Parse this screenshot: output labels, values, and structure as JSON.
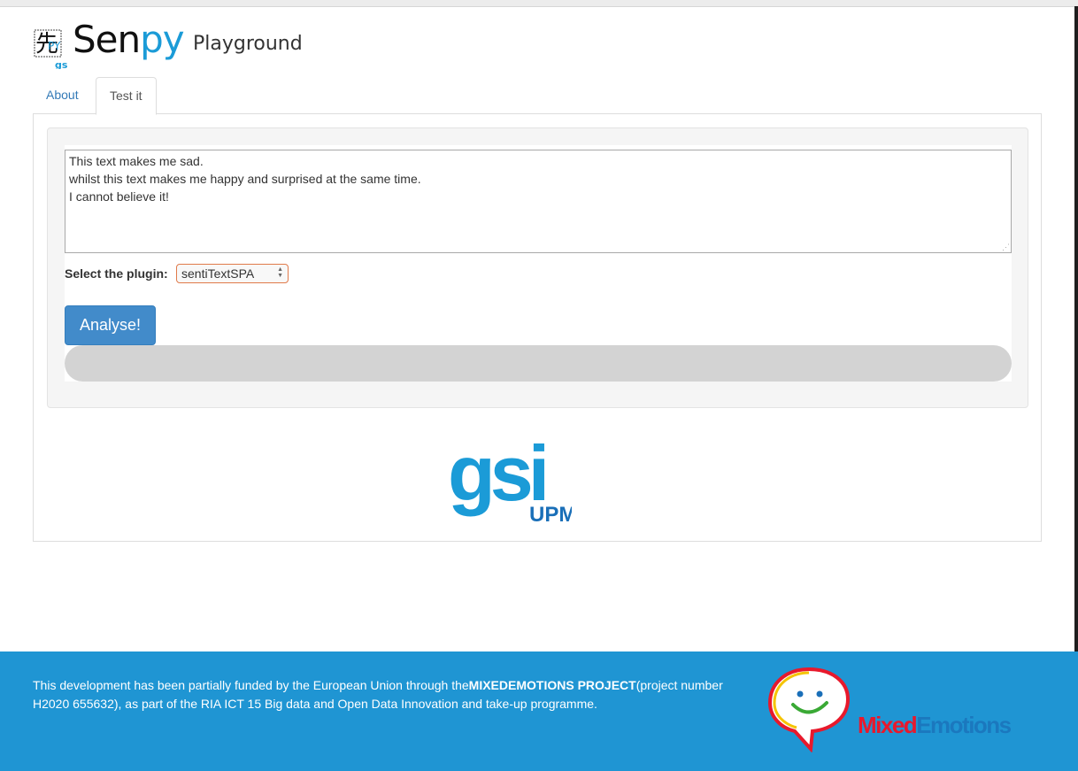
{
  "app": {
    "brand_sen": "Sen",
    "brand_py": "py",
    "brand_sub": "Playground"
  },
  "tabs": [
    {
      "label": "About",
      "active": false
    },
    {
      "label": "Test it",
      "active": true
    }
  ],
  "form": {
    "text_lines": [
      "This text makes me sad.",
      "whilst this text makes me happy and surprised at the same time.",
      "I cannot believe it!"
    ],
    "plugin_label": "Select the plugin:",
    "plugin_selected": "sentiTextSPA",
    "analyse_button": "Analyse!",
    "progress": 0
  },
  "gsi_logo": {
    "text": "gsi",
    "sub": "UPM"
  },
  "footer": {
    "text_before": "This development has been partially funded by the European Union through the",
    "project_name": "MIXEDEMOTIONS PROJECT",
    "text_after": "(project number H2020 655632), as part of the RIA ICT 15 Big data and Open Data Innovation and take-up programme.",
    "logo_mixed": "Mixed",
    "logo_emotions": "Emotions"
  },
  "colors": {
    "primary": "#428bca",
    "footer_bg": "#1f95d3",
    "brand_blue": "#1b9bd7",
    "mixed_red": "#e8192c"
  }
}
